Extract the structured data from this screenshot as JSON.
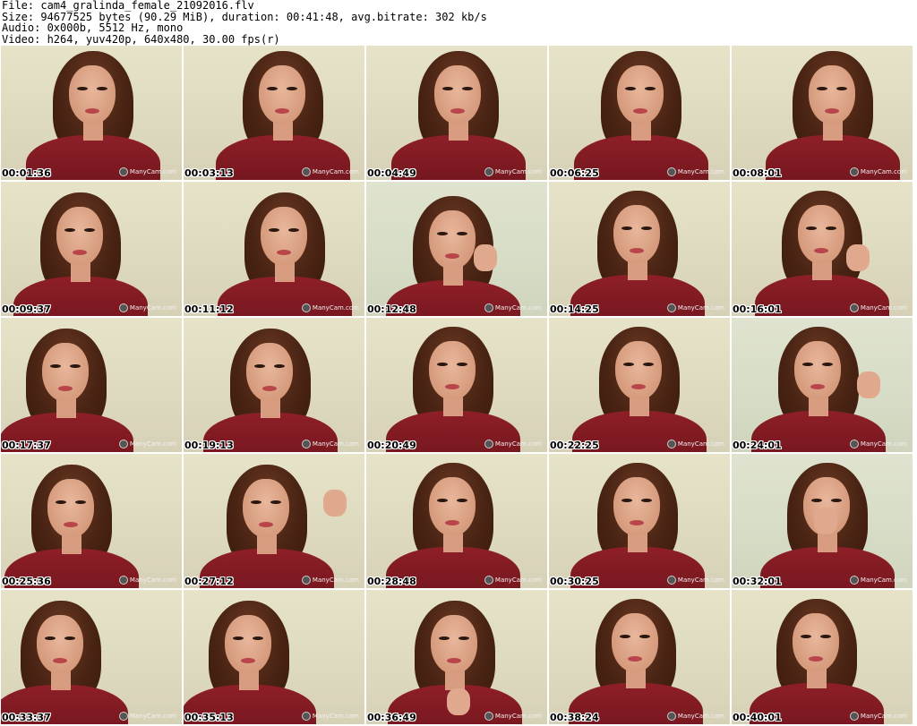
{
  "header": {
    "file": "File: cam4_gralinda_female_21092016.flv",
    "size": "Size: 94677525 bytes (90.29 MiB), duration: 00:41:48, avg.bitrate: 302 kb/s",
    "audio": "Audio: 0x000b, 5512 Hz, mono",
    "video": "Video: h264, yuv420p, 640x480, 30.00 fps(r)"
  },
  "watermark": "ManyCam.com",
  "thumbnails": [
    {
      "time": "00:01:36"
    },
    {
      "time": "00:03:13"
    },
    {
      "time": "00:04:49"
    },
    {
      "time": "00:06:25"
    },
    {
      "time": "00:08:01"
    },
    {
      "time": "00:09:37"
    },
    {
      "time": "00:11:12"
    },
    {
      "time": "00:12:48"
    },
    {
      "time": "00:14:25"
    },
    {
      "time": "00:16:01"
    },
    {
      "time": "00:17:37"
    },
    {
      "time": "00:19:13"
    },
    {
      "time": "00:20:49"
    },
    {
      "time": "00:22:25"
    },
    {
      "time": "00:24:01"
    },
    {
      "time": "00:25:36"
    },
    {
      "time": "00:27:12"
    },
    {
      "time": "00:28:48"
    },
    {
      "time": "00:30:25"
    },
    {
      "time": "00:32:01"
    },
    {
      "time": "00:33:37"
    },
    {
      "time": "00:35:13"
    },
    {
      "time": "00:36:49"
    },
    {
      "time": "00:38:24"
    },
    {
      "time": "00:40:01"
    }
  ],
  "colors": {
    "background": "#ffffff",
    "sweater": "#8e1f28",
    "hair": "#4a2414",
    "wall": "#e6e3c9"
  }
}
